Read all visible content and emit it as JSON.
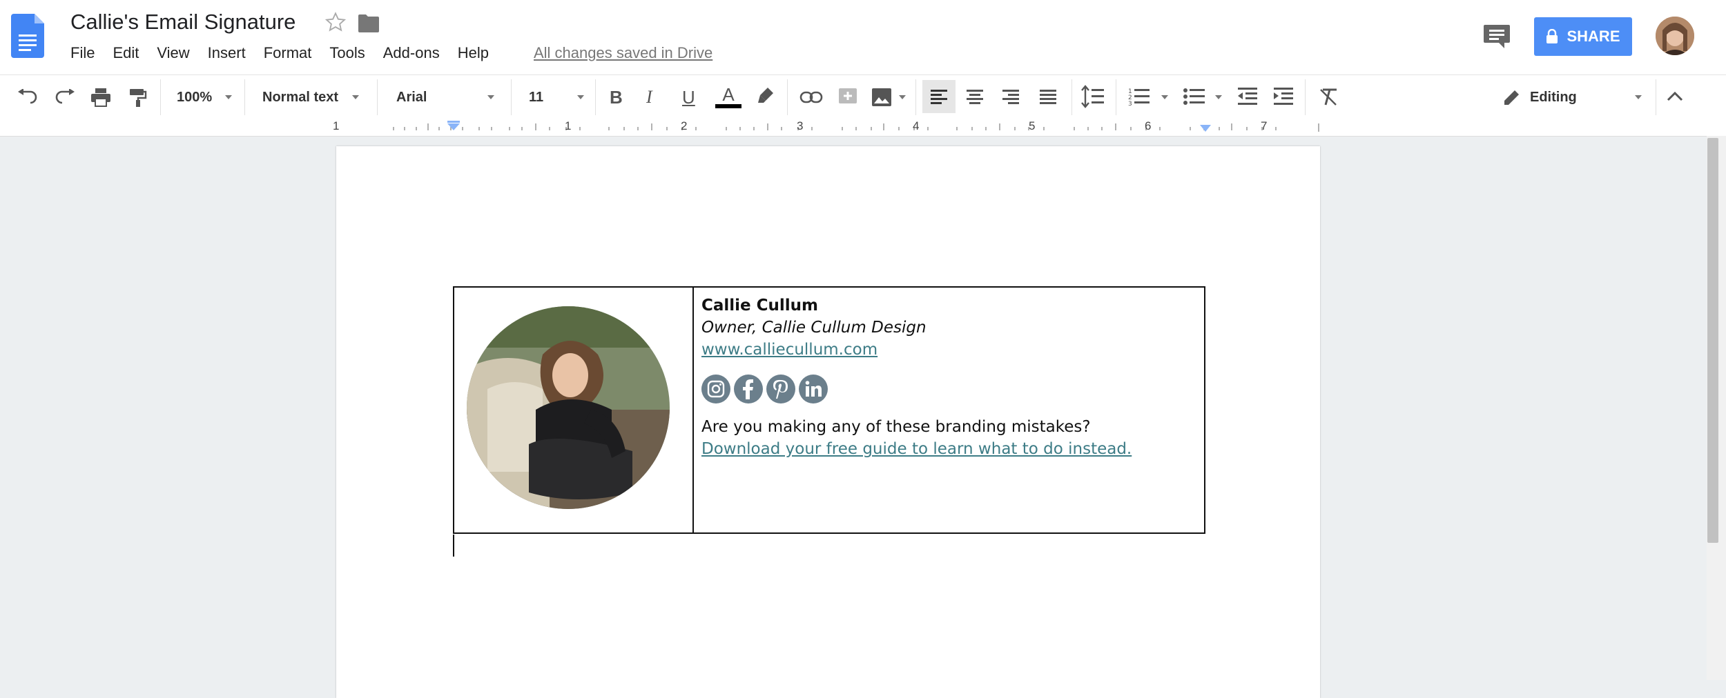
{
  "header": {
    "title": "Callie's Email Signature",
    "menu": [
      "File",
      "Edit",
      "View",
      "Insert",
      "Format",
      "Tools",
      "Add-ons",
      "Help"
    ],
    "saved_status": "All changes saved in Drive",
    "share_label": "SHARE"
  },
  "toolbar": {
    "zoom": "100%",
    "style": "Normal text",
    "font": "Arial",
    "font_size": "11",
    "mode": "Editing"
  },
  "ruler": {
    "marks": [
      "1",
      "1",
      "2",
      "3",
      "4",
      "5",
      "6",
      "7"
    ]
  },
  "signature": {
    "name": "Callie Cullum",
    "role": "Owner, Callie Cullum Design",
    "website": "www.calliecullum.com",
    "social_icons": [
      "instagram-icon",
      "facebook-icon",
      "pinterest-icon",
      "linkedin-icon"
    ],
    "question": "Are you making any of these branding mistakes?",
    "guide_link": "Download your free guide to learn what to do instead."
  },
  "colors": {
    "share": "#4d8ef6",
    "link": "#3d7c86",
    "docs_blue": "#4285f4"
  }
}
